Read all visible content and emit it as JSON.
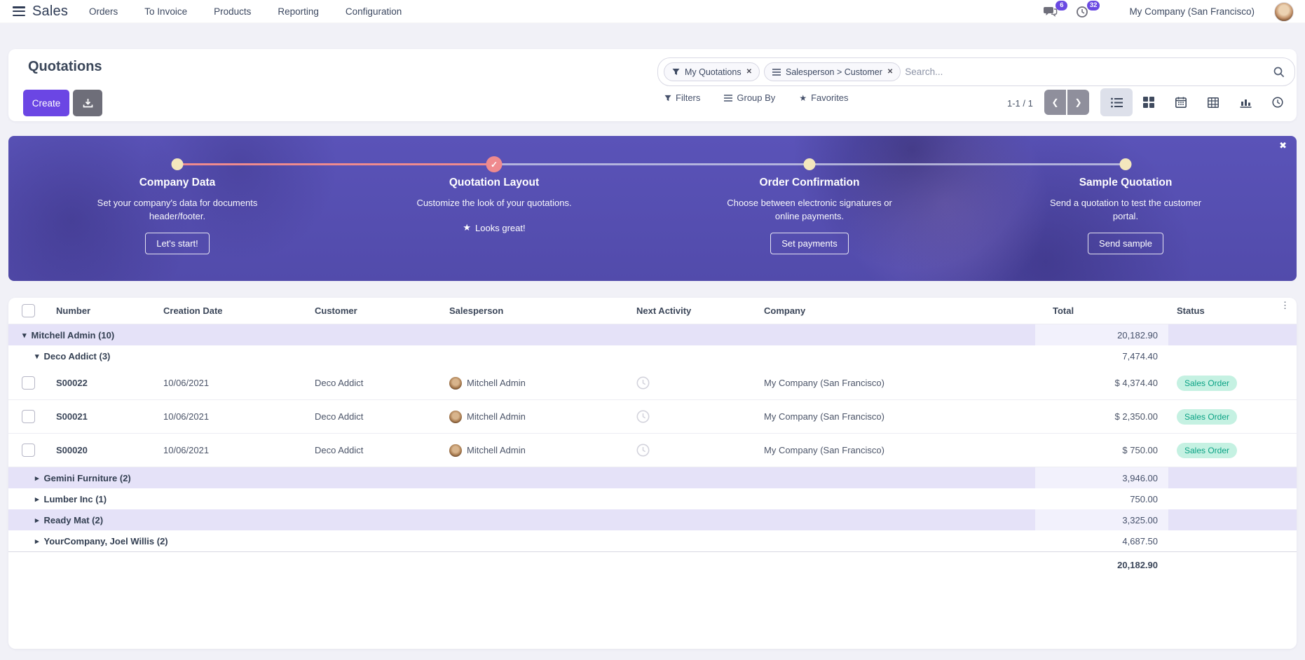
{
  "nav": {
    "app_name": "Sales",
    "menus": [
      "Orders",
      "To Invoice",
      "Products",
      "Reporting",
      "Configuration"
    ],
    "messages_badge": "6",
    "activities_badge": "32",
    "company": "My Company (San Francisco)"
  },
  "control_panel": {
    "title": "Quotations",
    "create_label": "Create",
    "search": {
      "facets": [
        {
          "icon": "filter-icon",
          "label": "My Quotations"
        },
        {
          "icon": "group-by-icon",
          "label": "Salesperson > Customer"
        }
      ],
      "placeholder": "Search..."
    },
    "filters_label": "Filters",
    "group_by_label": "Group By",
    "favorites_label": "Favorites",
    "pager": "1-1 / 1"
  },
  "onboarding": {
    "steps": [
      {
        "title": "Company Data",
        "description": "Set your company's data for documents header/footer.",
        "action": "Let's start!",
        "state": "todo"
      },
      {
        "title": "Quotation Layout",
        "description": "Customize the look of your quotations.",
        "action": "Looks great!",
        "state": "done"
      },
      {
        "title": "Order Confirmation",
        "description": "Choose between electronic signatures or online payments.",
        "action": "Set payments",
        "state": "todo"
      },
      {
        "title": "Sample Quotation",
        "description": "Send a quotation to test the customer portal.",
        "action": "Send sample",
        "state": "todo"
      }
    ]
  },
  "table": {
    "columns": {
      "number": "Number",
      "date": "Creation Date",
      "customer": "Customer",
      "salesperson": "Salesperson",
      "activity": "Next Activity",
      "company": "Company",
      "total": "Total",
      "status": "Status"
    },
    "rows": [
      {
        "type": "group",
        "label": "Mitchell Admin (10)",
        "total": "20,182.90"
      },
      {
        "type": "group",
        "label": "Deco Addict (3)",
        "total": "7,474.40"
      },
      {
        "type": "record",
        "number": "S00022",
        "date": "10/06/2021",
        "customer": "Deco Addict",
        "salesperson": "Mitchell Admin",
        "company": "My Company (San Francisco)",
        "total": "$ 4,374.40",
        "status": "Sales Order"
      },
      {
        "type": "record",
        "number": "S00021",
        "date": "10/06/2021",
        "customer": "Deco Addict",
        "salesperson": "Mitchell Admin",
        "company": "My Company (San Francisco)",
        "total": "$ 2,350.00",
        "status": "Sales Order"
      },
      {
        "type": "record",
        "number": "S00020",
        "date": "10/06/2021",
        "customer": "Deco Addict",
        "salesperson": "Mitchell Admin",
        "company": "My Company (San Francisco)",
        "total": "$ 750.00",
        "status": "Sales Order"
      },
      {
        "type": "group",
        "label": "Gemini Furniture (2)",
        "total": "3,946.00"
      },
      {
        "type": "group",
        "label": "Lumber Inc (1)",
        "total": "750.00"
      },
      {
        "type": "group",
        "label": "Ready Mat (2)",
        "total": "3,325.00"
      },
      {
        "type": "group",
        "label": "YourCompany, Joel Willis (2)",
        "total": "4,687.50"
      }
    ],
    "footer_total": "20,182.90"
  },
  "icons": {
    "caret_down": "▾",
    "caret_right": "▸",
    "kebab": "⋮",
    "close": "✖",
    "chip_remove": "✕",
    "star": "★",
    "check": "✓",
    "chev_left": "❮",
    "chev_right": "❯"
  },
  "colors": {
    "accent_purple": "#6b46e4",
    "banner_purple": "#5751b3",
    "step_done": "#ef8a8e",
    "step_todo_dot": "#f3e7bd",
    "group_row_bg": "#e5e2f8",
    "status_badge_bg": "#c5f1e2",
    "status_badge_text": "#0aa284"
  }
}
